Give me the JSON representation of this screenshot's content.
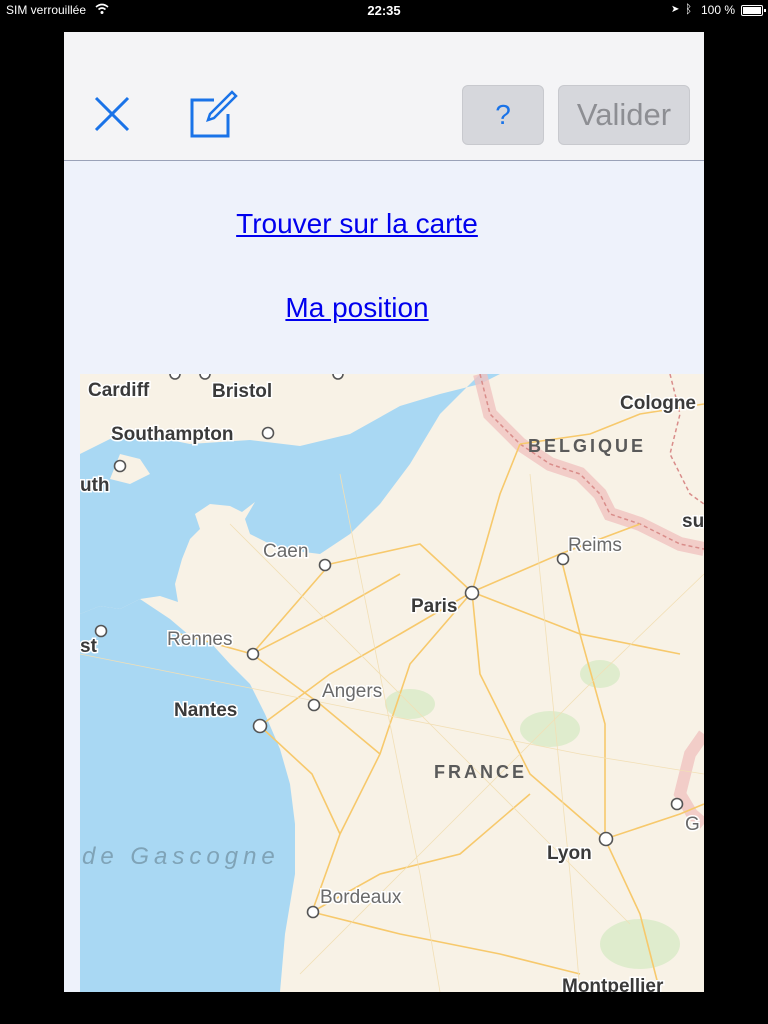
{
  "status_bar": {
    "carrier": "SIM verrouillée",
    "time": "22:35",
    "battery": "100 %"
  },
  "toolbar": {
    "close_icon": "close-icon",
    "edit_icon": "edit-icon",
    "help_label": "?",
    "validate_label": "Valider"
  },
  "links": {
    "find_on_map": "Trouver sur la carte",
    "my_position": "Ma position"
  },
  "map": {
    "colors": {
      "sea": "#a9d8f3",
      "land": "#f8f2e6",
      "roads": "#f7c96c",
      "border": "#e8a7a3"
    },
    "cities": [
      "Cardiff",
      "Bristol",
      "Cologne",
      "Southampton",
      "uth",
      "Caen",
      "Reims",
      "Paris",
      "st",
      "Rennes",
      "Angers",
      "Nantes",
      "Lyon",
      "Bordeaux",
      "Montpellier",
      "su",
      "G"
    ],
    "countries": [
      "BELGIQUE",
      "FRANCE"
    ],
    "sea": "de Gascogne"
  }
}
